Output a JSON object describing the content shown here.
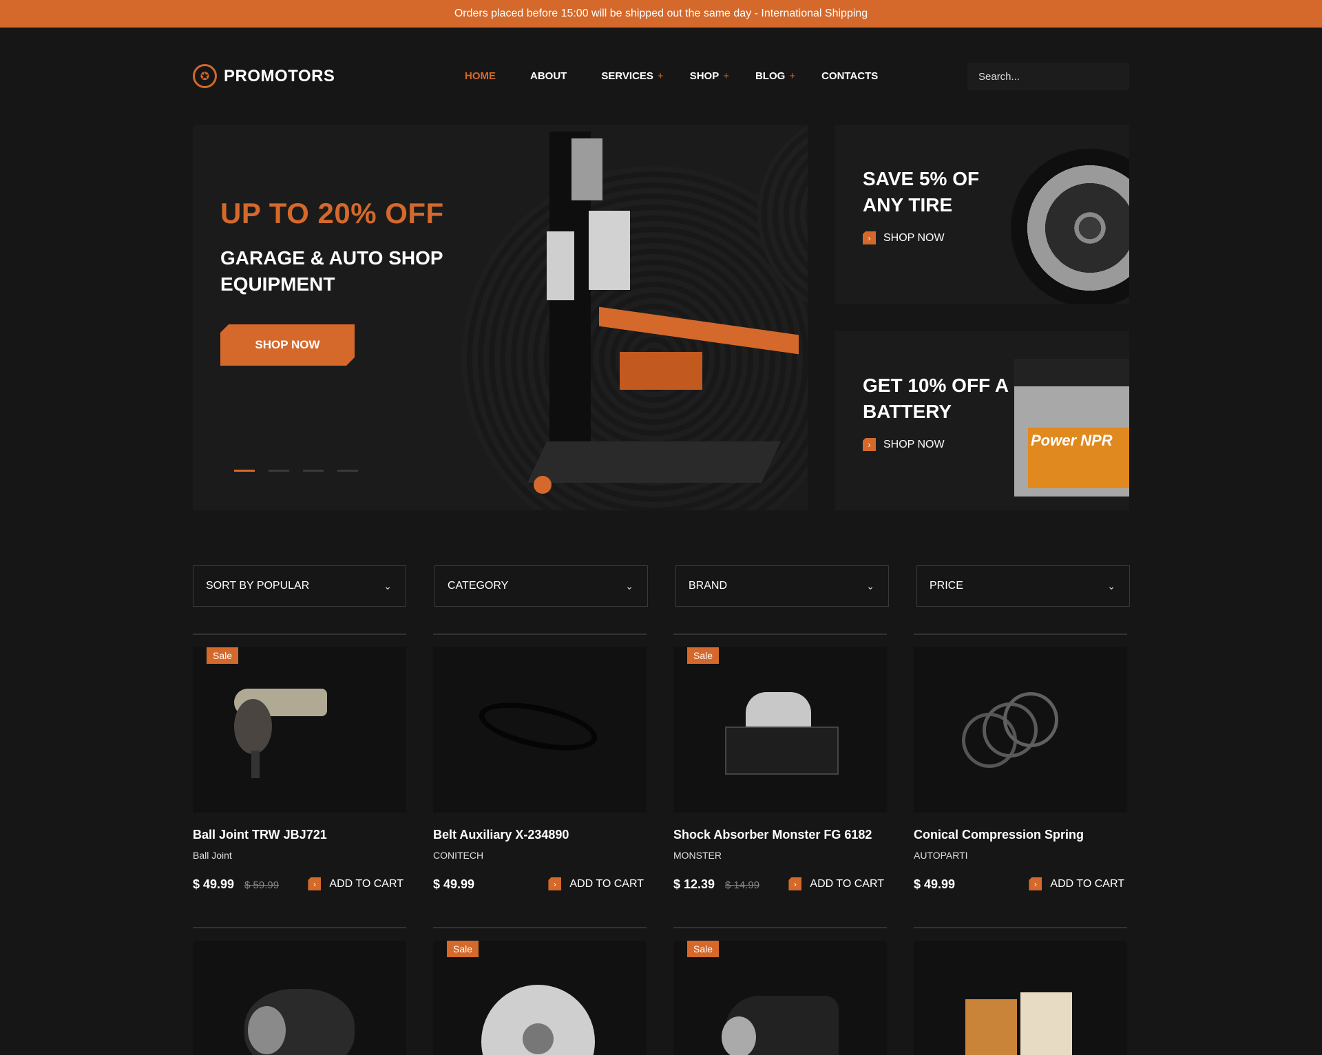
{
  "topbar": {
    "text": "Orders placed before 15:00 will be shipped out the same day - International Shipping"
  },
  "header": {
    "logo_text": "PROMOTORS",
    "nav": [
      {
        "label": "HOME",
        "has_submenu": false
      },
      {
        "label": "ABOUT",
        "has_submenu": false
      },
      {
        "label": "SERVICES",
        "has_submenu": true
      },
      {
        "label": "SHOP",
        "has_submenu": true
      },
      {
        "label": "BLOG",
        "has_submenu": true
      },
      {
        "label": "CONTACTS",
        "has_submenu": false
      }
    ],
    "submenu_glyph": "+",
    "search_placeholder": "Search..."
  },
  "hero": {
    "title": "UP TO 20% OFF",
    "subtitle": "GARAGE & AUTO SHOP EQUIPMENT",
    "button": "SHOP NOW",
    "slides": 4,
    "active_slide": 1
  },
  "promos": [
    {
      "title": "SAVE 5% OF ANY TIRE",
      "link": "SHOP NOW"
    },
    {
      "title": "GET  10% OFF A BATTERY",
      "link": "SHOP NOW",
      "label_text": "Power NPR"
    }
  ],
  "filters": [
    {
      "label": "SORT BY POPULAR"
    },
    {
      "label": "CATEGORY"
    },
    {
      "label": "BRAND"
    },
    {
      "label": "PRICE"
    }
  ],
  "products": [
    {
      "name": "Ball Joint TRW JBJ721",
      "brand": "Ball Joint",
      "price": "$ 49.99",
      "old_price": "$ 59.99",
      "sale": true,
      "cart": "ADD TO CART"
    },
    {
      "name": "Belt Auxiliary X-234890",
      "brand": "CONITECH",
      "price": "$ 49.99",
      "old_price": "",
      "sale": false,
      "cart": "ADD TO CART"
    },
    {
      "name": "Shock Absorber Monster FG 6182",
      "brand": "MONSTER",
      "price": "$ 12.39",
      "old_price": "$ 14.99",
      "sale": true,
      "cart": "ADD TO CART"
    },
    {
      "name": "Conical Compression Spring",
      "brand": "AUTOPARTI",
      "price": "$ 49.99",
      "old_price": "",
      "sale": false,
      "cart": "ADD TO CART"
    }
  ],
  "products_row2": [
    {
      "sale": false
    },
    {
      "sale": true
    },
    {
      "sale": true
    },
    {
      "sale": false
    }
  ],
  "sale_label": "Sale",
  "colors": {
    "accent": "#d4692b",
    "background": "#161616",
    "panel": "#1b1b1b"
  }
}
